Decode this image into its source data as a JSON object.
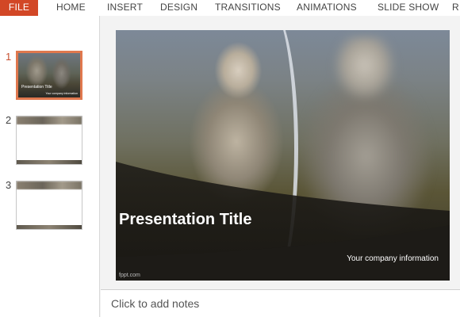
{
  "ribbon": {
    "file": "FILE",
    "home": "HOME",
    "insert": "INSERT",
    "design": "DESIGN",
    "transitions": "TRANSITIONS",
    "animations": "ANIMATIONS",
    "slide_show": "SLIDE SHOW",
    "review_partial": "R"
  },
  "thumbnails": [
    {
      "number": "1",
      "selected": true
    },
    {
      "number": "2",
      "selected": false
    },
    {
      "number": "3",
      "selected": false
    }
  ],
  "slide": {
    "title": "Presentation Title",
    "company": "Your company information",
    "footer": "fppt.com"
  },
  "notes": {
    "placeholder": "Click to add notes"
  },
  "colors": {
    "file_tab": "#d24726",
    "selection": "#e0784e"
  }
}
